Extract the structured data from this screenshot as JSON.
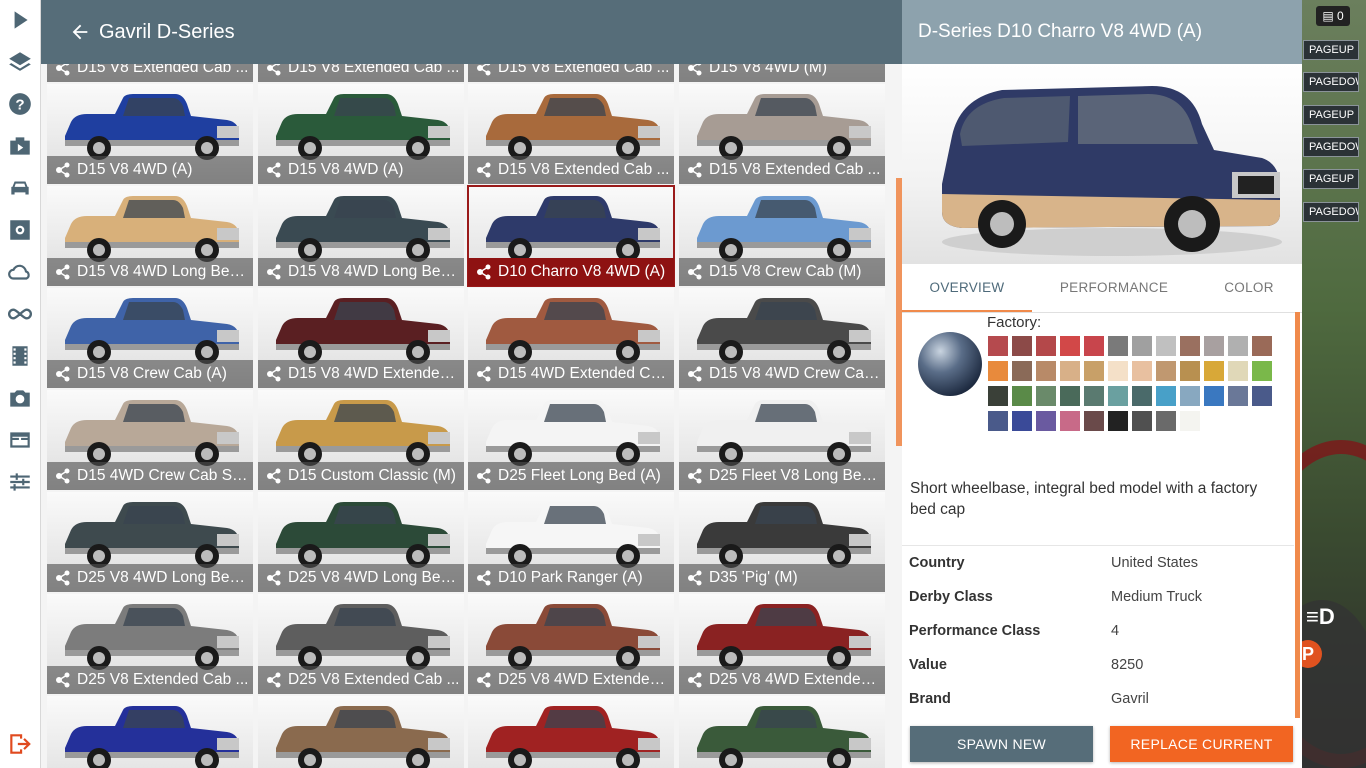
{
  "sidebar": {
    "items": [
      {
        "name": "play-icon"
      },
      {
        "name": "layers-icon"
      },
      {
        "name": "help-icon"
      },
      {
        "name": "scenarios-icon"
      },
      {
        "name": "vehicle-icon"
      },
      {
        "name": "settings-icon"
      },
      {
        "name": "cloud-icon"
      },
      {
        "name": "infinity-icon"
      },
      {
        "name": "film-icon"
      },
      {
        "name": "camera-icon"
      },
      {
        "name": "window-icon"
      },
      {
        "name": "sliders-icon"
      }
    ],
    "exit_icon": "exit-icon"
  },
  "header": {
    "title": "Gavril D-Series",
    "back_icon": "arrow-left-icon"
  },
  "vehicles": [
    {
      "label": "D15 V8 Extended Cab ...",
      "color": "#6e6e6e"
    },
    {
      "label": "D15 V8 Extended Cab ...",
      "color": "#7a6a5a"
    },
    {
      "label": "D15 V8 Extended Cab ...",
      "color": "#777777"
    },
    {
      "label": "D15 V8 4WD (M)",
      "color": "#7a7a7a"
    },
    {
      "label": "D15 V8 4WD (A)",
      "color": "#1f3fa0"
    },
    {
      "label": "D15 V8 4WD (A)",
      "color": "#2a5a3a"
    },
    {
      "label": "D15 V8 Extended Cab ...",
      "color": "#a86a3c"
    },
    {
      "label": "D15 V8 Extended Cab ...",
      "color": "#a79c94"
    },
    {
      "label": "D15 V8 4WD Long Bed...",
      "color": "#d8b07a"
    },
    {
      "label": "D15 V8 4WD Long Bed...",
      "color": "#3a4a52"
    },
    {
      "label": "D10 Charro V8 4WD (A)",
      "color": "#2e3a6a"
    },
    {
      "label": "D15 V8 Crew Cab (M)",
      "color": "#6c9ad0"
    },
    {
      "label": "D15 V8 Crew Cab (A)",
      "color": "#3f63a8"
    },
    {
      "label": "D15 V8 4WD Extended...",
      "color": "#5a1f22"
    },
    {
      "label": "D15 4WD Extended Ca...",
      "color": "#a05a40"
    },
    {
      "label": "D15 V8 4WD Crew Cab...",
      "color": "#4a4a4a"
    },
    {
      "label": "D15 4WD Crew Cab Sh...",
      "color": "#b8a898"
    },
    {
      "label": "D15 Custom Classic (M)",
      "color": "#c89a4a"
    },
    {
      "label": "D25 Fleet Long Bed (A)",
      "color": "#f4f4f4"
    },
    {
      "label": "D25 Fleet V8 Long Bed...",
      "color": "#f0f0f0"
    },
    {
      "label": "D25 V8 4WD Long Bed...",
      "color": "#3e4a4e"
    },
    {
      "label": "D25 V8 4WD Long Bed...",
      "color": "#2c4a38"
    },
    {
      "label": "D10 Park Ranger (A)",
      "color": "#f6f6f6"
    },
    {
      "label": "D35 'Pig' (M)",
      "color": "#3a3a3a"
    },
    {
      "label": "D25 V8 Extended Cab ...",
      "color": "#7c7c7c"
    },
    {
      "label": "D25 V8 Extended Cab ...",
      "color": "#5e5e5e"
    },
    {
      "label": "D25 V8 4WD Extended...",
      "color": "#8a4a38"
    },
    {
      "label": "D25 V8 4WD Extended...",
      "color": "#8a2222"
    },
    {
      "label": "",
      "color": "#24309a"
    },
    {
      "label": "",
      "color": "#8a6a4e"
    },
    {
      "label": "",
      "color": "#a02222"
    },
    {
      "label": "",
      "color": "#3a5a3a"
    }
  ],
  "selected_index": 10,
  "detail": {
    "title": "D-Series D10 Charro V8 4WD (A)",
    "tabs": [
      "OVERVIEW",
      "PERFORMANCE",
      "COLOR"
    ],
    "active_tab": "OVERVIEW",
    "paint_label": "Factory:",
    "swatches": [
      "#b54a4e",
      "#8c4a48",
      "#b4484a",
      "#d24848",
      "#c8454c",
      "#7a7a7a",
      "#a0a0a0",
      "#c0c0c0",
      "#9a7060",
      "#a8a0a0",
      "#b0b0b0",
      "#9a6a58",
      "#e88a3c",
      "#8a6a58",
      "#b88a68",
      "#d8b088",
      "#c8a068",
      "#f4e0c8",
      "#e8c0a0",
      "#c09870",
      "#b89050",
      "#d8a838",
      "#e0d8b8",
      "#7ab84a",
      "#3a4038",
      "#5a8a48",
      "#6a8a6a",
      "#4a6a5a",
      "#5a7a70",
      "#6aa0a0",
      "#4a6a6a",
      "#48a0c8",
      "#88a8c0",
      "#3a78c0",
      "#6a7898",
      "#4a5a8a",
      "#4a5a8a",
      "#3a4a98",
      "#6a5aa0",
      "#c86a88",
      "#6a4a4a",
      "#222222",
      "#505050",
      "#6a6a6a",
      "#f4f4f0"
    ],
    "description": "Short wheelbase, integral bed model with a factory bed cap",
    "info": [
      {
        "key": "Country",
        "value": "United States"
      },
      {
        "key": "Derby Class",
        "value": "Medium Truck"
      },
      {
        "key": "Performance Class",
        "value": "4"
      },
      {
        "key": "Value",
        "value": "8250"
      },
      {
        "key": "Brand",
        "value": "Gavril"
      }
    ],
    "spawn_label": "SPAWN NEW",
    "replace_label": "REPLACE CURRENT"
  },
  "hud": {
    "message_count": "0",
    "key_hints": [
      "PAGEUP",
      "PAGEDOWN",
      "PAGEUP",
      "PAGEDOWN",
      "PAGEUP",
      "PAGEDOWN"
    ],
    "headlight_icon": "headlight-icon",
    "parking_label": "P"
  },
  "colors": {
    "header": "#566d79",
    "detail_header": "#8da2ad",
    "accent": "#f08a4b",
    "replace": "#f26522",
    "selected": "#8e1212"
  }
}
